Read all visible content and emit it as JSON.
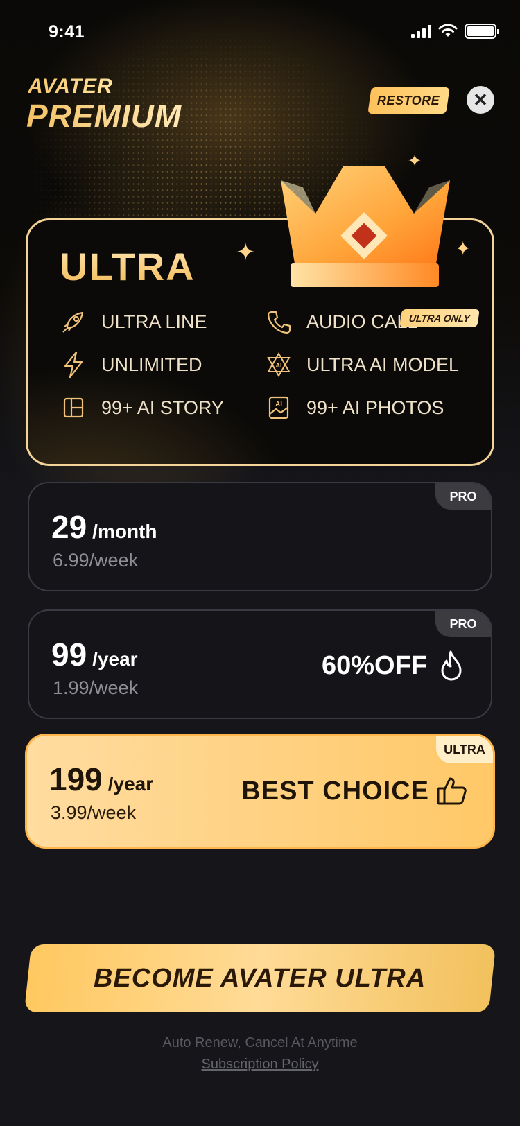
{
  "status_bar": {
    "time": "9:41"
  },
  "brand": {
    "top": "AVATER",
    "main": "PREMIUM"
  },
  "header": {
    "restore_label": "RESTORE",
    "close_icon": "close-icon"
  },
  "ultra_card": {
    "title": "ULTRA",
    "ultra_only_badge": "ULTRA ONLY",
    "features": [
      {
        "label": "ULTRA LINE",
        "icon": "rocket-icon"
      },
      {
        "label": "AUDIO CALL",
        "icon": "phone-icon"
      },
      {
        "label": "UNLIMITED",
        "icon": "lightning-icon"
      },
      {
        "label": "ULTRA AI MODEL",
        "icon": "ai-star-icon"
      },
      {
        "label": "99+ AI STORY",
        "icon": "story-icon"
      },
      {
        "label": "99+ AI PHOTOS",
        "icon": "ai-photo-icon"
      }
    ]
  },
  "plans": [
    {
      "badge": "PRO",
      "price": "29",
      "unit": "/month",
      "weekly": "6.99/week"
    },
    {
      "badge": "PRO",
      "price": "99",
      "unit": "/year",
      "weekly": "1.99/week",
      "tag": "60%OFF",
      "tag_icon": "fire-icon"
    },
    {
      "badge": "ULTRA",
      "price": "199",
      "unit": "/year",
      "weekly": "3.99/week",
      "tag": "BEST CHOICE",
      "tag_icon": "thumbs-up-icon"
    }
  ],
  "cta": {
    "label": "BECOME AVATER ULTRA"
  },
  "footer": {
    "renew": "Auto Renew, Cancel At Anytime",
    "policy": "Subscription Policy"
  },
  "colors": {
    "gold": "#f4c265",
    "card_border": "#f5d49a",
    "plan_border": "#3a3a42",
    "background": "#15151a"
  }
}
